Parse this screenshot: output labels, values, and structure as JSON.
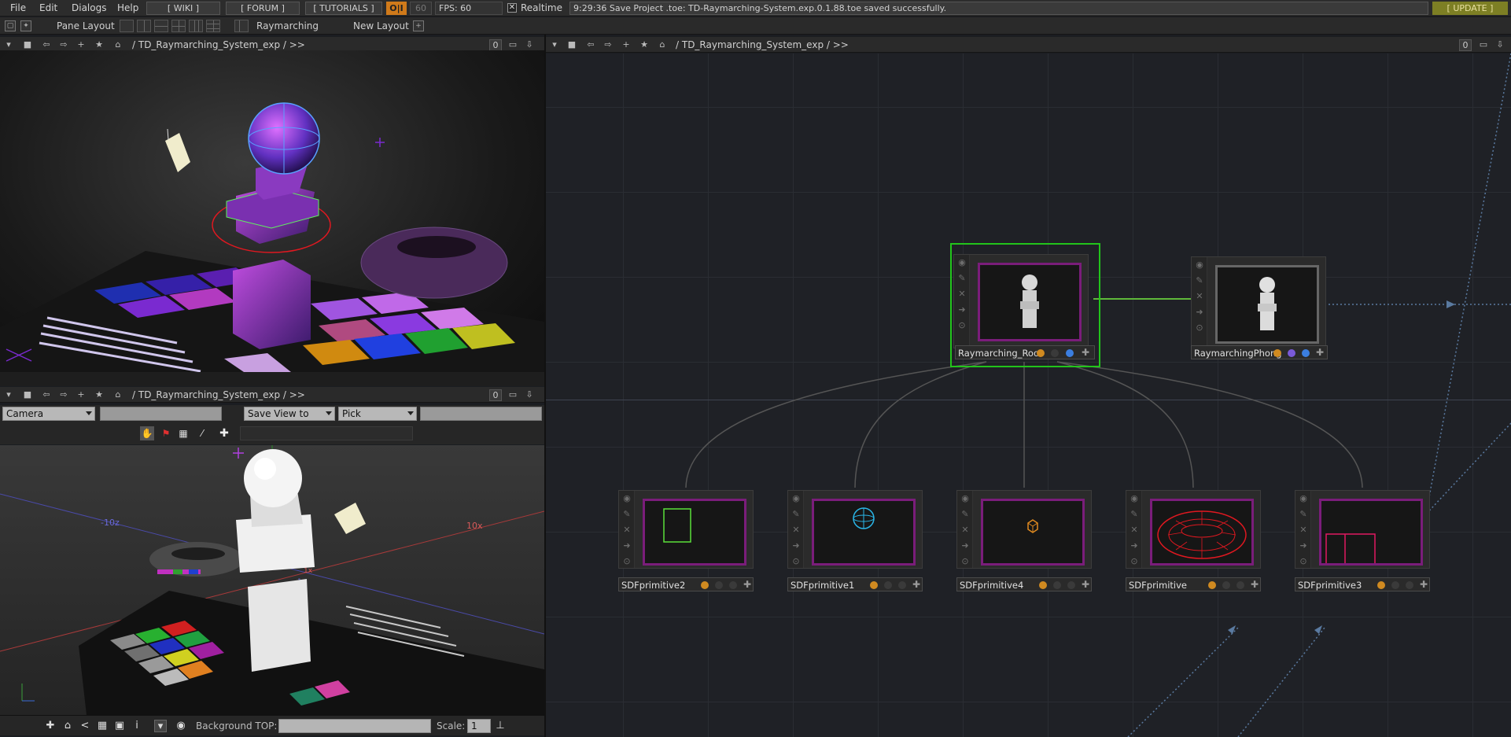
{
  "menu": {
    "file": "File",
    "edit": "Edit",
    "dialogs": "Dialogs",
    "help": "Help"
  },
  "top_buttons": {
    "wiki": "[ WIKI ]",
    "forum": "[ FORUM ]",
    "tutorials": "[ TUTORIALS ]",
    "oi": "O|I",
    "fps_target": "60",
    "fps": "FPS:  60",
    "realtime_check": "✕",
    "realtime": "Realtime",
    "update": "[ UPDATE ]"
  },
  "status_message": "9:29:36 Save Project .toe: TD-Raymarching-System.exp.0.1.88.toe saved successfully.",
  "layoutbar": {
    "pane_layout": "Pane Layout",
    "tab_name": "Raymarching",
    "new_layout": "New Layout",
    "add": "+"
  },
  "panes": {
    "top_left": {
      "path": "/ TD_Raymarching_System_exp / >>",
      "zero": "0"
    },
    "bottom_left": {
      "path": "/ TD_Raymarching_System_exp / >>",
      "zero": "0"
    },
    "right": {
      "path": "/ TD_Raymarching_System_exp / >>",
      "zero": "0"
    }
  },
  "geo_viewer": {
    "camera": "Camera",
    "save_view": "Save View to",
    "pick": "Pick",
    "background_label": "Background TOP:",
    "scale_label": "Scale:",
    "scale_value": "1",
    "axis_labels": {
      "z": "-10z",
      "x": "10x",
      "x_small": "1x",
      "z_small": "1z"
    }
  },
  "nodes": [
    {
      "name": "Raymarching_Root",
      "selected": true
    },
    {
      "name": "RaymarchingPhong",
      "selected": false
    },
    {
      "name": "SDFprimitive2"
    },
    {
      "name": "SDFprimitive1"
    },
    {
      "name": "SDFprimitive4"
    },
    {
      "name": "SDFprimitive"
    },
    {
      "name": "SDFprimitive3"
    }
  ],
  "colors": {
    "accent_selected": "#22c41b",
    "node_border": "#7a1d7a",
    "update": "#7d7f24",
    "oi": "#d07a1a"
  }
}
